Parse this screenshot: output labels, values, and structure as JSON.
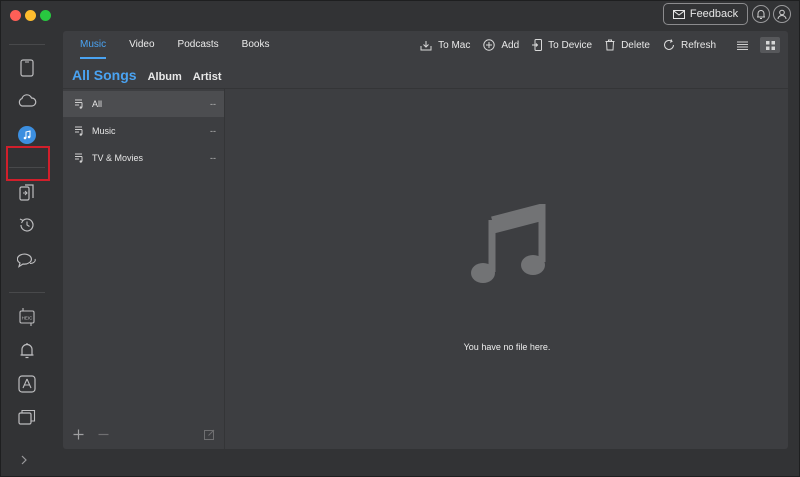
{
  "header": {
    "feedback_label": "Feedback"
  },
  "tabs": [
    {
      "label": "Music",
      "active": true
    },
    {
      "label": "Video",
      "active": false
    },
    {
      "label": "Podcasts",
      "active": false
    },
    {
      "label": "Books",
      "active": false
    }
  ],
  "toolbar": {
    "to_mac": "To Mac",
    "add": "Add",
    "to_device": "To Device",
    "delete": "Delete",
    "refresh": "Refresh"
  },
  "subtabs": {
    "all_songs": "All Songs",
    "album": "Album",
    "artist": "Artist"
  },
  "library": [
    {
      "label": "All",
      "count": "--",
      "selected": true
    },
    {
      "label": "Music",
      "count": "--",
      "selected": false
    },
    {
      "label": "TV & Movies",
      "count": "--",
      "selected": false
    }
  ],
  "empty_state": {
    "message": "You have no file here."
  },
  "colors": {
    "accent": "#4aa3f2",
    "highlight_box": "#d11f2b",
    "music_icon_bg": "#3c8fe0"
  },
  "icons": {
    "rail": [
      "phone-icon",
      "cloud-icon",
      "music-note-icon",
      "device-transfer-icon",
      "history-icon",
      "chat-icon",
      "heic-convert-icon",
      "notification-bell-icon",
      "app-store-icon",
      "cards-icon"
    ]
  }
}
